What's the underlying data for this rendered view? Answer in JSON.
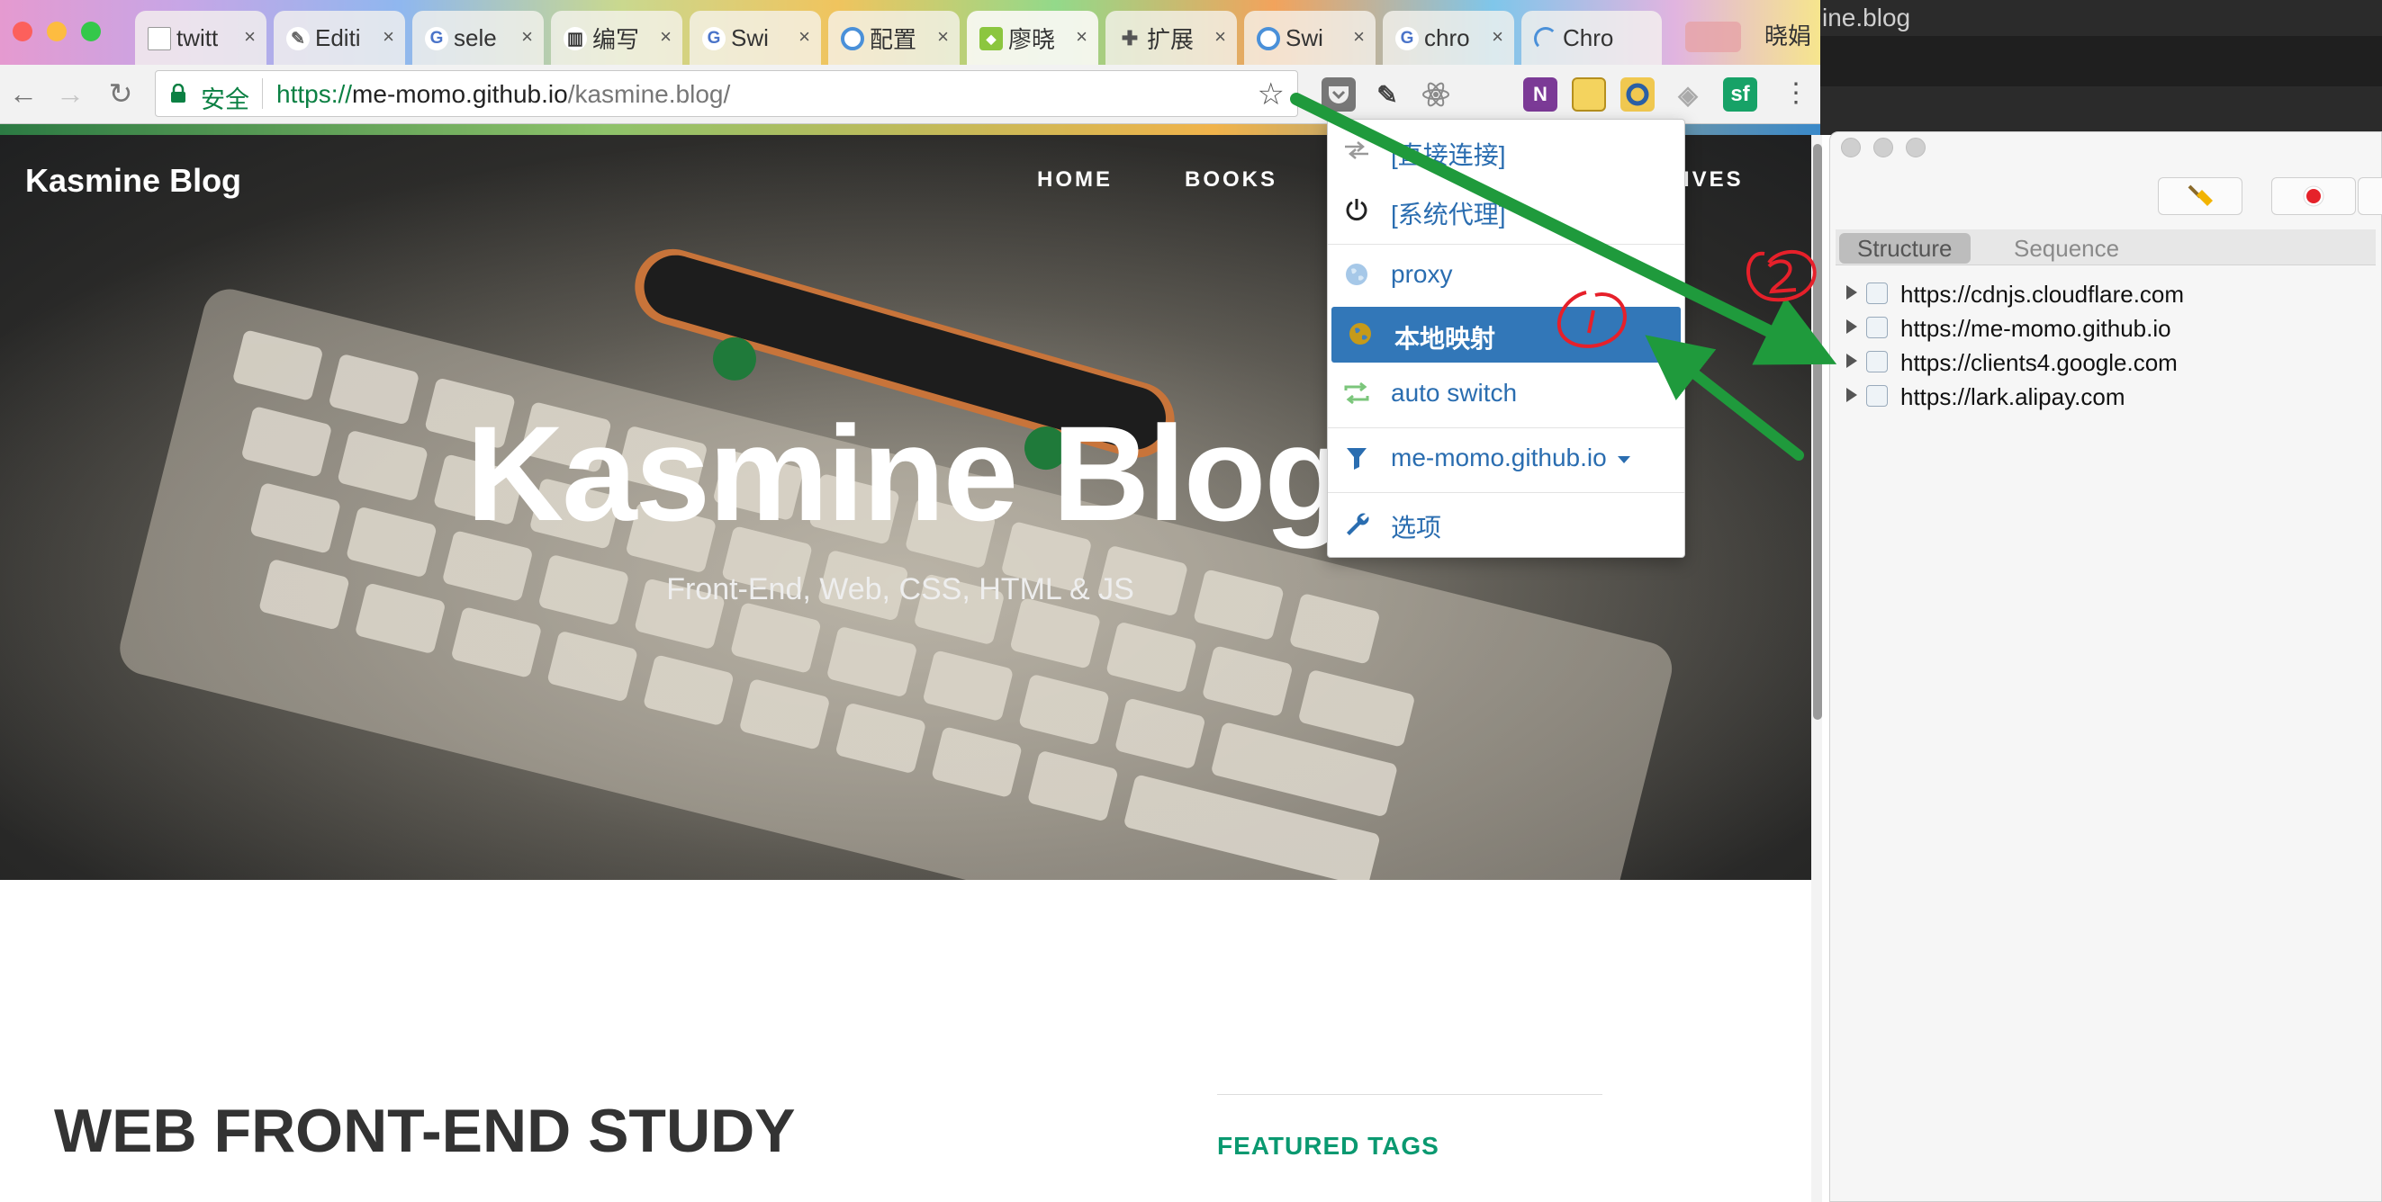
{
  "browser": {
    "tabs": [
      {
        "label": "twitt",
        "icon": "document-icon"
      },
      {
        "label": "Editi",
        "icon": "pencil-icon"
      },
      {
        "label": "sele",
        "icon": "google-icon"
      },
      {
        "label": "编写",
        "icon": "book-icon"
      },
      {
        "label": "Swi",
        "icon": "google-icon"
      },
      {
        "label": "配置",
        "icon": "switchy-icon"
      },
      {
        "label": "廖晓",
        "icon": "site-icon"
      },
      {
        "label": "扩展",
        "icon": "puzzle-icon"
      },
      {
        "label": "Swi",
        "icon": "switchy-icon"
      },
      {
        "label": "chro",
        "icon": "google-icon"
      },
      {
        "label": "Chro",
        "icon": "loading-icon"
      }
    ],
    "tab_close_glyph": "×",
    "tab_overflow_label": "晓娟",
    "security_label": "安全",
    "url": {
      "scheme": "https://",
      "host": "me-momo.github.io",
      "path": "/kasmine.blog/"
    },
    "extensions": [
      "pocket-icon",
      "eyedropper-icon",
      "react-icon",
      "onenote-icon",
      "notes-icon",
      "switchyomega-icon",
      "layers-icon",
      "segmentfault-icon"
    ],
    "extension_labels": {
      "onenote": "N",
      "segmentfault": "sf"
    }
  },
  "page": {
    "brand": "Kasmine Blog",
    "nav": [
      "HOME",
      "BOOKS",
      "IVES"
    ],
    "hero_title": "Kasmine Blog",
    "hero_subtitle": "Front-End, Web, CSS, HTML & JS",
    "heading": "WEB FRONT-END STUDY",
    "featured_tags": "FEATURED TAGS"
  },
  "proxy_menu": {
    "items": [
      {
        "label": "[直接连接]",
        "icon": "direct-connection-icon"
      },
      {
        "label": "[系统代理]",
        "icon": "power-icon"
      },
      {
        "label": "proxy",
        "icon": "globe-icon"
      },
      {
        "label": "本地映射",
        "icon": "globe-icon",
        "active": true
      },
      {
        "label": "auto switch",
        "icon": "auto-switch-icon"
      },
      {
        "label": "me-momo.github.io",
        "icon": "filter-icon"
      },
      {
        "label": "选项",
        "icon": "wrench-icon"
      }
    ]
  },
  "right_window": {
    "caption": "ine.blog",
    "tabs": [
      "Structure",
      "Sequence"
    ],
    "selected_tab": "Structure",
    "hosts": [
      "https://cdnjs.cloudflare.com",
      "https://me-momo.github.io",
      "https://clients4.google.com",
      "https://lark.alipay.com"
    ]
  },
  "colors": {
    "accent_blue": "#3277b8",
    "link_blue": "#2a6db0",
    "secure_green": "#0b8043",
    "tag_green": "#0a9970",
    "annotation_green": "#1f9a3c",
    "annotation_red": "#e6202a"
  }
}
